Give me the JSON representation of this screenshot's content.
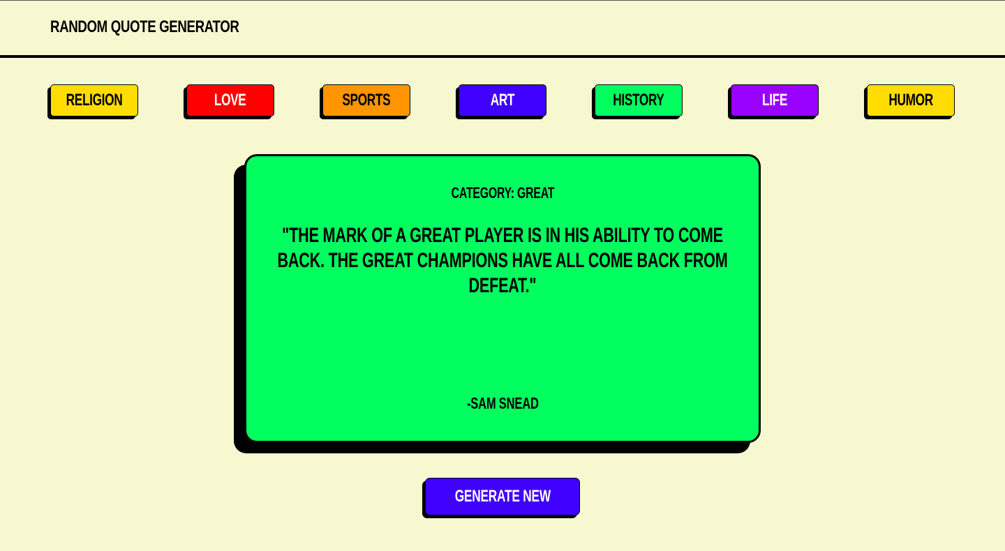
{
  "header": {
    "title": "RANDOM QUOTE GENERATOR"
  },
  "categories": [
    {
      "label": "RELIGION",
      "bg": "#ffdd00",
      "fg": "#000000"
    },
    {
      "label": "LOVE",
      "bg": "#ff0000",
      "fg": "#ffffff"
    },
    {
      "label": "SPORTS",
      "bg": "#ff9500",
      "fg": "#000000"
    },
    {
      "label": "ART",
      "bg": "#4000ff",
      "fg": "#ffffff"
    },
    {
      "label": "HISTORY",
      "bg": "#00ff5f",
      "fg": "#000000"
    },
    {
      "label": "LIFE",
      "bg": "#9900ff",
      "fg": "#ffffff"
    },
    {
      "label": "HUMOR",
      "bg": "#ffdd00",
      "fg": "#000000"
    }
  ],
  "quote_card": {
    "category_label": "CATEGORY: GREAT",
    "quote": "\"THE MARK OF A GREAT PLAYER IS IN HIS ABILITY TO COME BACK. THE GREAT CHAMPIONS HAVE ALL COME BACK FROM DEFEAT.\"",
    "author": "-SAM SNEAD",
    "bg": "#00ff5f"
  },
  "actions": {
    "generate_label": "GENERATE NEW",
    "generate_bg": "#4000ff"
  },
  "colors": {
    "page_bg": "#f7f7d0",
    "border": "#000000"
  }
}
